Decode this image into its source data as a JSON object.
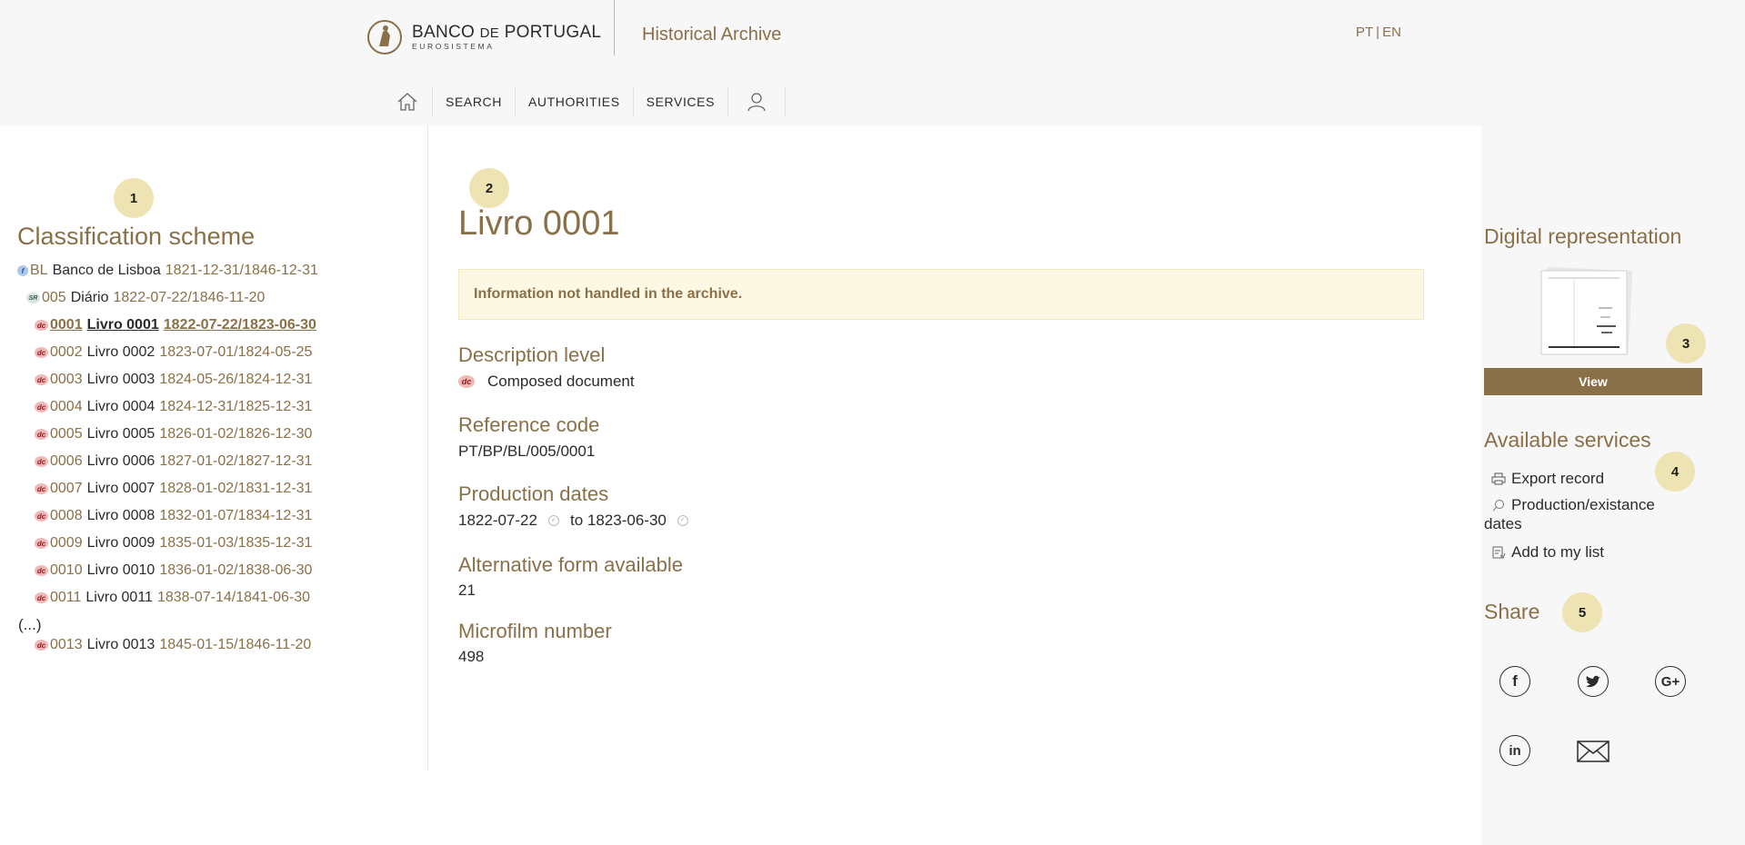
{
  "header": {
    "logo_main": "BANCO",
    "logo_de": "DE",
    "logo_main2": "PORTUGAL",
    "logo_sub": "EUROSISTEMA",
    "site_title": "Historical Archive",
    "lang_pt": "PT",
    "lang_sep": "|",
    "lang_en": "EN"
  },
  "nav": {
    "items": [
      {
        "label": "SEARCH"
      },
      {
        "label": "AUTHORITIES"
      },
      {
        "label": "SERVICES"
      }
    ]
  },
  "badges": [
    "1",
    "2",
    "3",
    "4",
    "5"
  ],
  "classification": {
    "heading": "Classification scheme",
    "rows": [
      {
        "icon": "f-level-icon",
        "icon_text": "f",
        "code": "BL",
        "title": "Banco de Lisboa",
        "dates": "1821-12-31/1846-12-31",
        "current": false
      },
      {
        "icon": "sr-level-icon",
        "icon_text": "SR",
        "code": "005",
        "title": "Diário",
        "dates": "1822-07-22/1846-11-20",
        "current": false
      },
      {
        "icon": "dc-level-icon",
        "icon_text": "dc",
        "code": "0001",
        "title": "Livro 0001",
        "dates": "1822-07-22/1823-06-30",
        "current": true
      },
      {
        "icon": "dc-level-icon",
        "icon_text": "dc",
        "code": "0002",
        "title": "Livro 0002",
        "dates": "1823-07-01/1824-05-25",
        "current": false
      },
      {
        "icon": "dc-level-icon",
        "icon_text": "dc",
        "code": "0003",
        "title": "Livro 0003",
        "dates": "1824-05-26/1824-12-31",
        "current": false
      },
      {
        "icon": "dc-level-icon",
        "icon_text": "dc",
        "code": "0004",
        "title": "Livro 0004",
        "dates": "1824-12-31/1825-12-31",
        "current": false
      },
      {
        "icon": "dc-level-icon",
        "icon_text": "dc",
        "code": "0005",
        "title": "Livro 0005",
        "dates": "1826-01-02/1826-12-30",
        "current": false
      },
      {
        "icon": "dc-level-icon",
        "icon_text": "dc",
        "code": "0006",
        "title": "Livro 0006",
        "dates": "1827-01-02/1827-12-31",
        "current": false
      },
      {
        "icon": "dc-level-icon",
        "icon_text": "dc",
        "code": "0007",
        "title": "Livro 0007",
        "dates": "1828-01-02/1831-12-31",
        "current": false
      },
      {
        "icon": "dc-level-icon",
        "icon_text": "dc",
        "code": "0008",
        "title": "Livro 0008",
        "dates": "1832-01-07/1834-12-31",
        "current": false
      },
      {
        "icon": "dc-level-icon",
        "icon_text": "dc",
        "code": "0009",
        "title": "Livro 0009",
        "dates": "1835-01-03/1835-12-31",
        "current": false
      },
      {
        "icon": "dc-level-icon",
        "icon_text": "dc",
        "code": "0010",
        "title": "Livro 0010",
        "dates": "1836-01-02/1838-06-30",
        "current": false
      },
      {
        "icon": "dc-level-icon",
        "icon_text": "dc",
        "code": "0011",
        "title": "Livro 0011",
        "dates": "1838-07-14/1841-06-30",
        "current": false
      }
    ],
    "ellipsis": "(...)",
    "last_row": {
      "icon": "dc-level-icon",
      "icon_text": "dc",
      "code": "0013",
      "title": "Livro 0013",
      "dates": "1845-01-15/1846-11-20"
    }
  },
  "record": {
    "title": "Livro 0001",
    "notice": "Information not handled in the archive.",
    "description_level_label": "Description level",
    "description_level_icon_text": "dc",
    "description_level_value": "Composed document",
    "reference_code_label": "Reference code",
    "reference_code_value": "PT/BP/BL/005/0001",
    "production_dates_label": "Production dates",
    "production_date_start": "1822-07-22",
    "production_date_to": "to",
    "production_date_end": "1823-06-30",
    "alt_form_label": "Alternative form available",
    "alt_form_value": "21",
    "microfilm_label": "Microfilm number",
    "microfilm_value": "498"
  },
  "sidebar": {
    "digital_title": "Digital representation",
    "view_label": "View",
    "services_title": "Available services",
    "services": [
      {
        "icon": "printer-icon",
        "label": "Export record"
      },
      {
        "icon": "search-icon",
        "label": "Production/existance dates"
      },
      {
        "icon": "add-to-list-icon",
        "label": "Add to my list"
      }
    ],
    "share_title": "Share",
    "share_icons": [
      "facebook-icon",
      "twitter-icon",
      "google-plus-icon",
      "linkedin-icon",
      "email-icon"
    ]
  },
  "colors": {
    "accent": "#8a7048",
    "notice_bg": "#fcf8e3",
    "badge_bg": "#ede3b3",
    "panel_bg": "#f7f7f7"
  }
}
